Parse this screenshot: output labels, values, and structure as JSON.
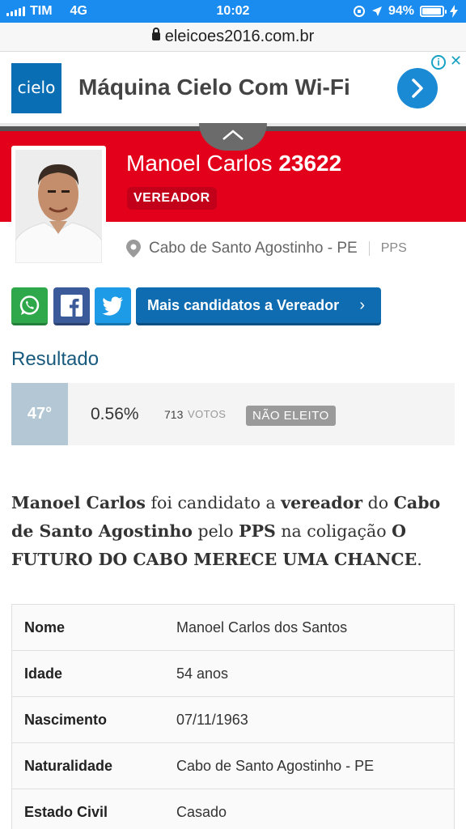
{
  "status_bar": {
    "carrier": "TIM",
    "network": "4G",
    "time": "10:02",
    "battery": "94%",
    "battery_level": 0.94
  },
  "browser": {
    "url": "eleicoes2016.com.br"
  },
  "ad": {
    "brand": "cielo",
    "title": "Máquina Cielo Com Wi-Fi",
    "colors": {
      "brand": "#0a6eb4",
      "button": "#1a8ad4"
    }
  },
  "candidate": {
    "name": "Manoel Carlos",
    "number": "23622",
    "role": "VEREADOR",
    "city": "Cabo de Santo Agostinho - PE",
    "party": "PPS"
  },
  "share": {
    "icons": [
      "whatsapp-icon",
      "facebook-icon",
      "twitter-icon"
    ],
    "more_label": "Mais candidatos a Vereador"
  },
  "result": {
    "heading": "Resultado",
    "rank": "47°",
    "percent": "0.56%",
    "votes": "713",
    "votes_label": "VOTOS",
    "status": "NÃO ELEITO"
  },
  "description": {
    "parts": [
      {
        "text": "Manoel Carlos",
        "bold": true
      },
      {
        "text": " foi candidato a ",
        "bold": false
      },
      {
        "text": "vereador",
        "bold": true
      },
      {
        "text": " do ",
        "bold": false
      },
      {
        "text": "Cabo de Santo Agostinho",
        "bold": true
      },
      {
        "text": " pelo ",
        "bold": false
      },
      {
        "text": "PPS",
        "bold": true
      },
      {
        "text": " na coligação ",
        "bold": false
      },
      {
        "text": "O FUTURO DO CABO MERECE UMA CHANCE",
        "bold": true
      },
      {
        "text": ".",
        "bold": false
      }
    ]
  },
  "info": [
    {
      "label": "Nome",
      "value": "Manoel Carlos dos Santos"
    },
    {
      "label": "Idade",
      "value": "54 anos"
    },
    {
      "label": "Nascimento",
      "value": "07/11/1963"
    },
    {
      "label": "Naturalidade",
      "value": "Cabo de Santo Agostinho - PE"
    },
    {
      "label": "Estado Civil",
      "value": "Casado"
    }
  ],
  "colors": {
    "header_red": "#e3001b",
    "badge_red": "#c2001a",
    "primary_blue": "#0f6cb0",
    "heading_blue": "#185a7d",
    "status_gray": "#9a9a9a"
  }
}
